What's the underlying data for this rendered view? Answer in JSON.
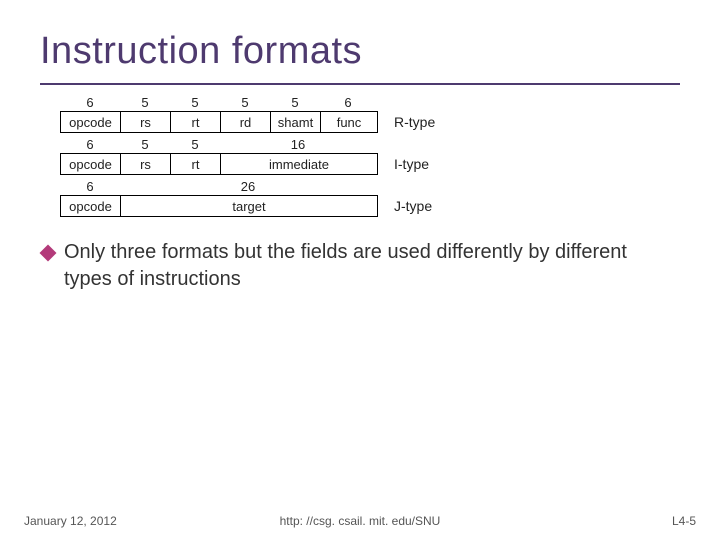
{
  "title": "Instruction formats",
  "types": {
    "r": "R-type",
    "i": "I-type",
    "j": "J-type"
  },
  "r_row": {
    "widths": [
      "6",
      "5",
      "5",
      "5",
      "5",
      "6"
    ],
    "fields": [
      "opcode",
      "rs",
      "rt",
      "rd",
      "shamt",
      "func"
    ]
  },
  "i_row": {
    "widths": [
      "6",
      "5",
      "5",
      "16"
    ],
    "fields": [
      "opcode",
      "rs",
      "rt",
      "immediate"
    ]
  },
  "j_row": {
    "widths": [
      "6",
      "26"
    ],
    "fields": [
      "opcode",
      "target"
    ]
  },
  "bullet": "Only three formats but the fields are used differently by different types of instructions",
  "footer": {
    "date": "January 12, 2012",
    "url": "http: //csg. csail. mit. edu/SNU",
    "page": "L4-5"
  }
}
